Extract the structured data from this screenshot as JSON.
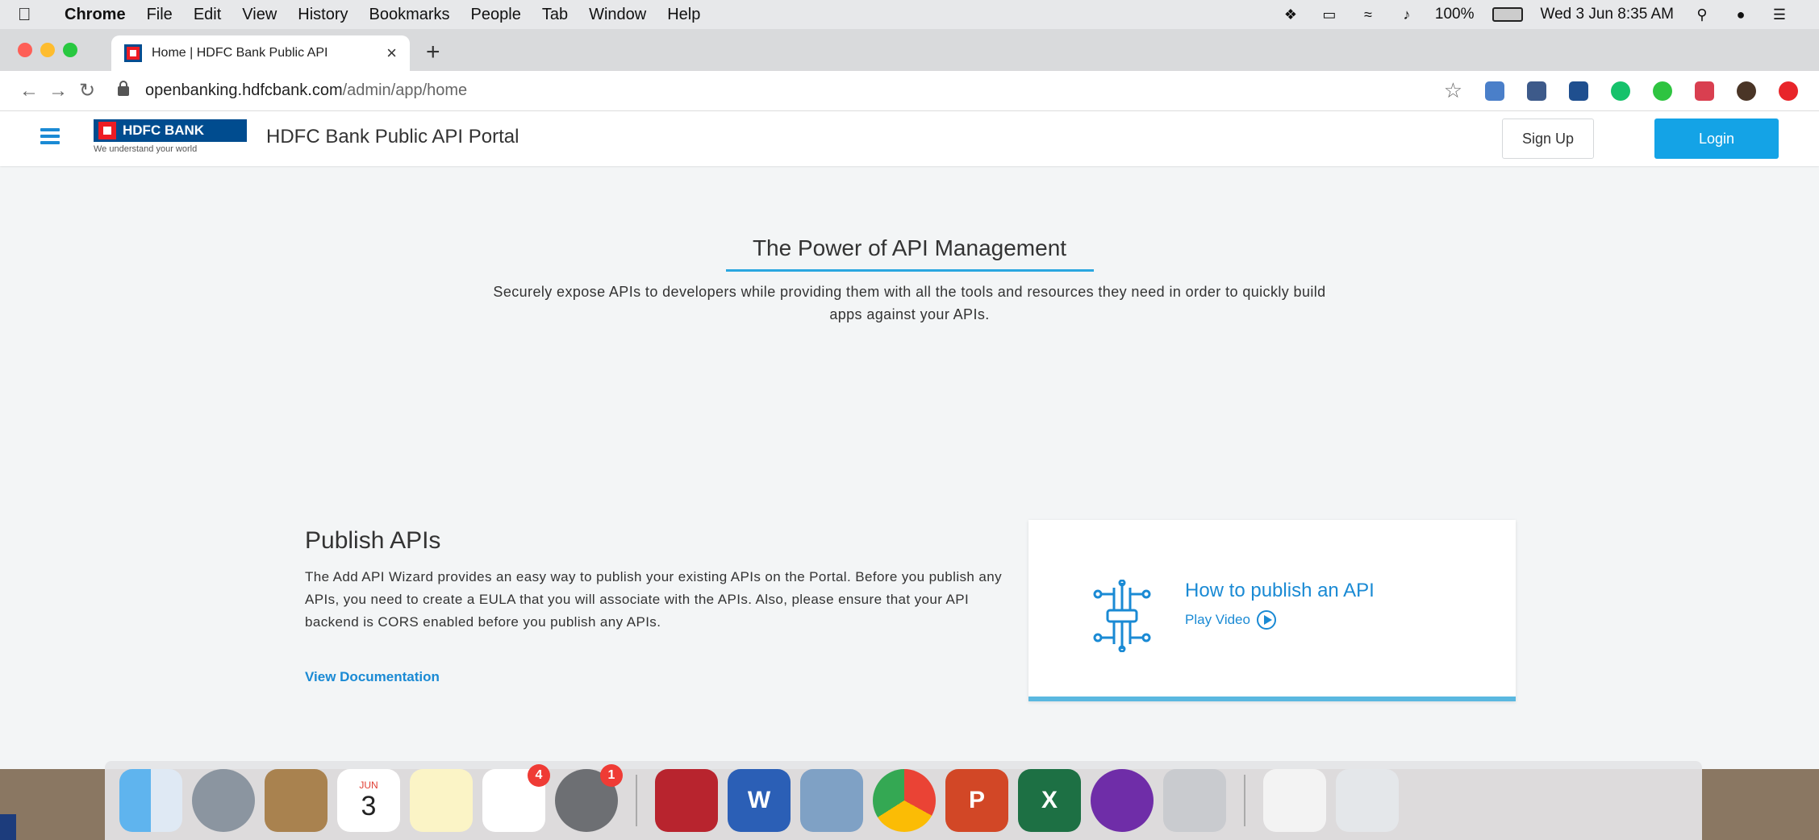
{
  "menubar": {
    "app": "Chrome",
    "items": [
      "File",
      "Edit",
      "View",
      "History",
      "Bookmarks",
      "People",
      "Tab",
      "Window",
      "Help"
    ],
    "battery": "100%",
    "datetime": "Wed 3 Jun  8:35 AM"
  },
  "browser": {
    "tab_title": "Home | HDFC Bank Public API",
    "tab_close": "×",
    "new_tab": "+",
    "url_host": "openbanking.hdfcbank.com",
    "url_path": "/admin/app/home"
  },
  "header": {
    "logo_text": "HDFC BANK",
    "logo_tagline": "We understand your world",
    "portal_title": "HDFC Bank Public API Portal",
    "signup_label": "Sign Up",
    "login_label": "Login"
  },
  "hero": {
    "title": "The Power of API Management",
    "description": "Securely expose APIs to developers while providing them with all the tools and resources they need in order to quickly build apps against your APIs."
  },
  "publish": {
    "title": "Publish APIs",
    "description": "The Add API Wizard provides an easy way to publish your existing APIs on the Portal. Before you publish any APIs, you need to create a EULA that you will associate with the APIs. Also, please ensure that your API backend is CORS enabled before you publish any APIs.",
    "link": "View Documentation"
  },
  "video_card": {
    "title": "How to publish an API",
    "play_label": "Play Video"
  },
  "dock": {
    "calendar_month": "JUN",
    "calendar_day": "3",
    "reminders_badge": "4",
    "prefs_badge": "1"
  },
  "colors": {
    "accent": "#14a3e6",
    "link": "#1a8ad4",
    "hdfc_blue": "#004c8f",
    "hdfc_red": "#ed1c24"
  }
}
